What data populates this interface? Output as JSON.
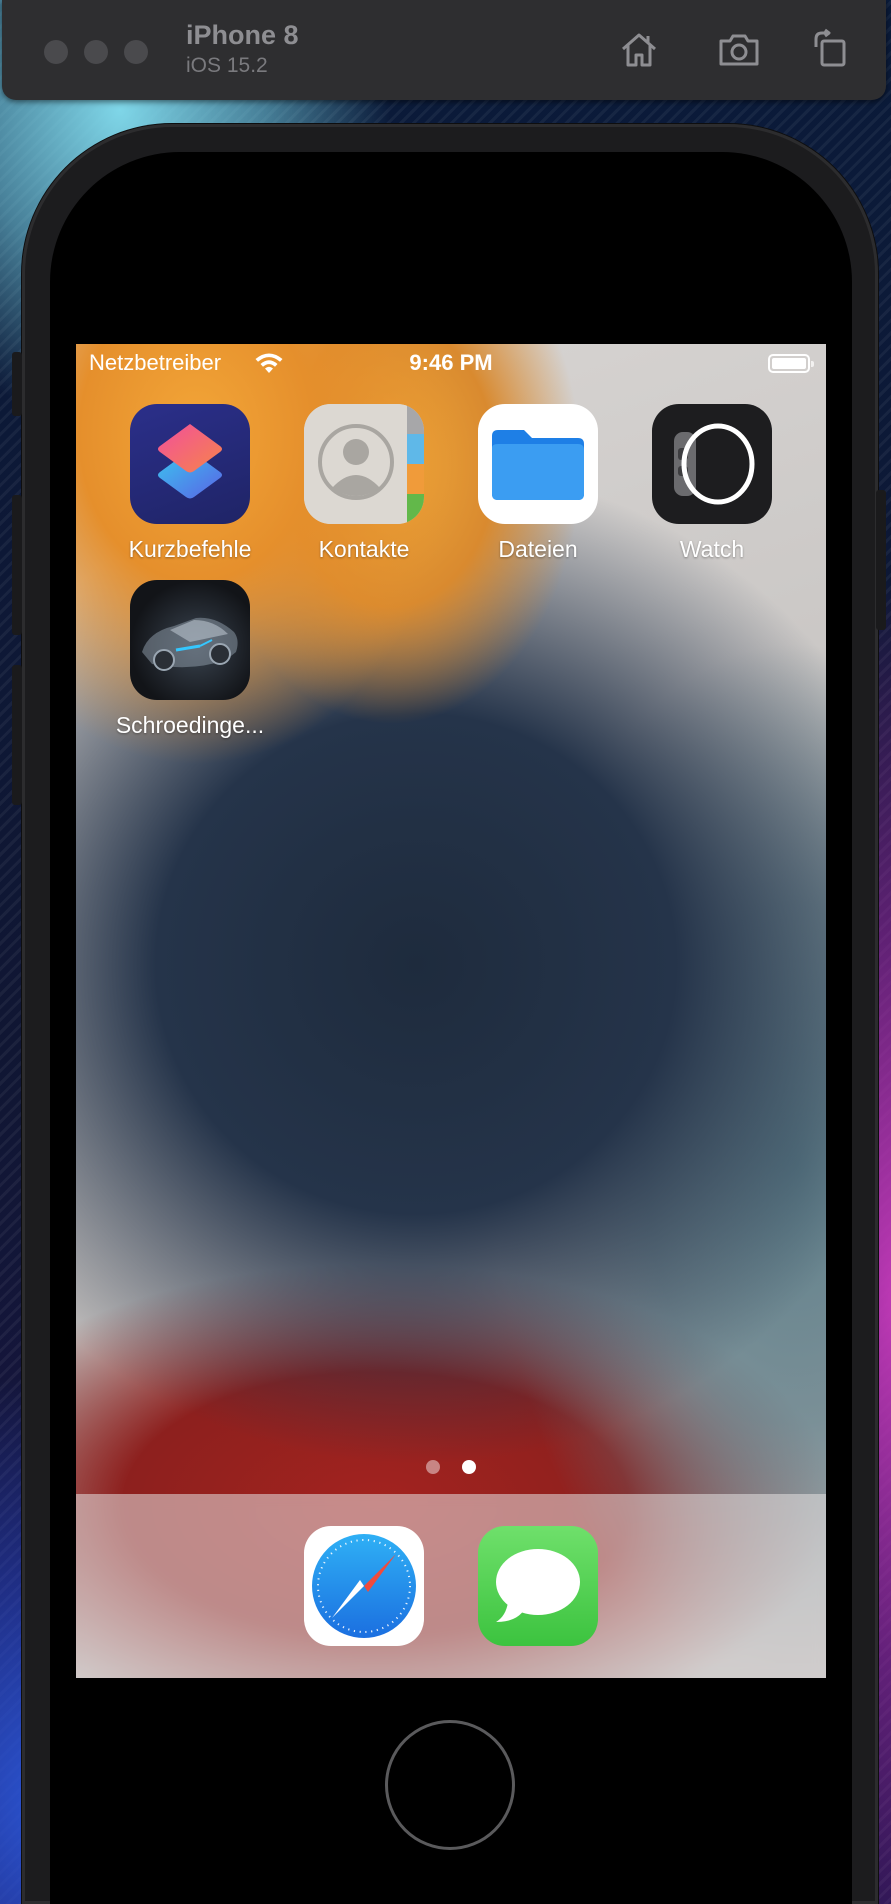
{
  "window": {
    "device_name": "iPhone 8",
    "os_version": "iOS 15.2",
    "toolbar_icons": [
      "home-icon",
      "screenshot-icon",
      "rotate-icon"
    ]
  },
  "status_bar": {
    "carrier": "Netzbetreiber",
    "time": "9:46 PM",
    "battery_level": 1.0
  },
  "apps": [
    {
      "label": "Kurzbefehle",
      "icon": "shortcuts-icon"
    },
    {
      "label": "Kontakte",
      "icon": "contacts-icon"
    },
    {
      "label": "Dateien",
      "icon": "files-icon"
    },
    {
      "label": "Watch",
      "icon": "watch-icon"
    },
    {
      "label": "Schroedinge...",
      "icon": "car-app-icon"
    }
  ],
  "page_indicator": {
    "pages": 2,
    "current": 2
  },
  "dock": [
    {
      "icon": "safari-icon"
    },
    {
      "icon": "messages-icon"
    }
  ]
}
